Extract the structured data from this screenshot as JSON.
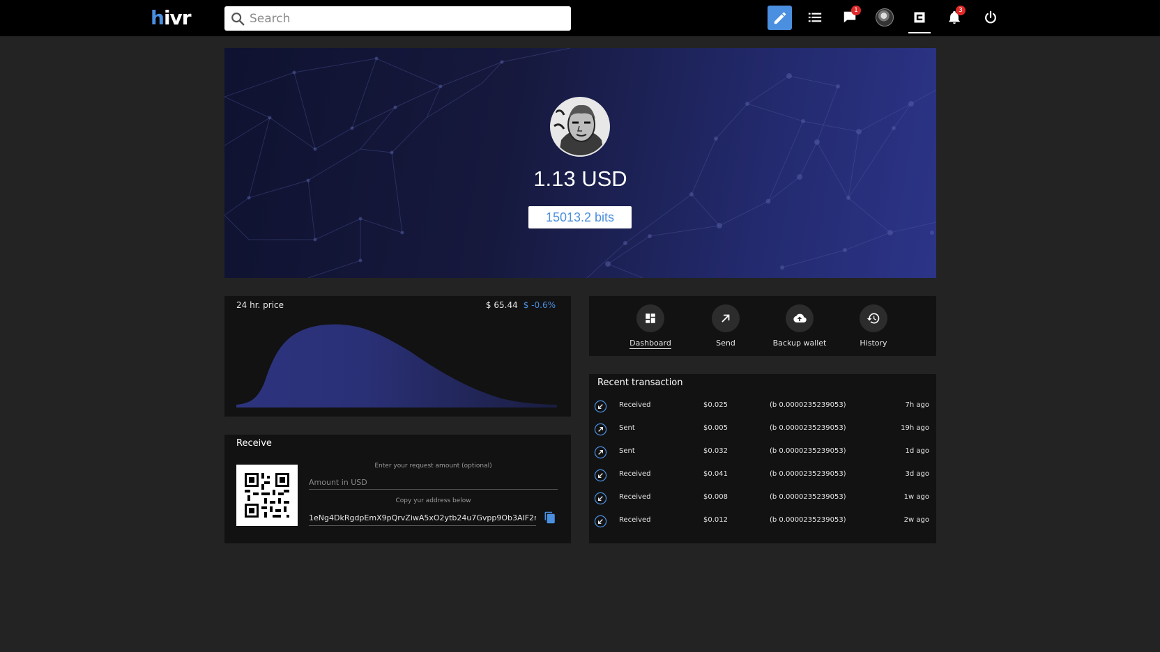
{
  "app": {
    "logo_text": "hivr"
  },
  "search": {
    "placeholder": "Search"
  },
  "nav": {
    "messages_badge": "1",
    "notifications_badge": "3"
  },
  "wallet": {
    "balance_usd": "1.13 USD",
    "balance_bits": "15013.2 bits"
  },
  "price": {
    "label": "24 hr. price",
    "value": "$ 65.44",
    "change": "$ -0.6%"
  },
  "actions": [
    {
      "label": "Dashboard",
      "icon": "dashboard-icon",
      "active": true
    },
    {
      "label": "Send",
      "icon": "send-arrow-icon",
      "active": false
    },
    {
      "label": "Backup wallet",
      "icon": "cloud-upload-icon",
      "active": false
    },
    {
      "label": "History",
      "icon": "history-icon",
      "active": false
    }
  ],
  "receive": {
    "title": "Receive",
    "request_hint": "Enter your request amount (optional)",
    "amount_placeholder": "Amount in USD",
    "copy_hint": "Copy yur address below",
    "address": "1eNg4DkRgdpEmX9pQrvZiwA5xO2ytb24u7Gvpp9Ob3AIF2r..."
  },
  "transactions": {
    "title": "Recent transaction",
    "rows": [
      {
        "type": "Received",
        "usd": "$0.025",
        "bits": "(b 0.0000235239053)",
        "time": "7h ago",
        "direction": "in"
      },
      {
        "type": "Sent",
        "usd": "$0.005",
        "bits": "(b 0.0000235239053)",
        "time": "19h ago",
        "direction": "out"
      },
      {
        "type": "Sent",
        "usd": "$0.032",
        "bits": "(b 0.0000235239053)",
        "time": "1d ago",
        "direction": "out"
      },
      {
        "type": "Received",
        "usd": "$0.041",
        "bits": "(b 0.0000235239053)",
        "time": "3d ago",
        "direction": "in"
      },
      {
        "type": "Received",
        "usd": "$0.008",
        "bits": "(b 0.0000235239053)",
        "time": "1w ago",
        "direction": "in"
      },
      {
        "type": "Received",
        "usd": "$0.012",
        "bits": "(b 0.0000235239053)",
        "time": "2w ago",
        "direction": "in"
      }
    ]
  },
  "colors": {
    "accent": "#4a8fe0",
    "badge": "#e02a2a",
    "hero_dark": "#0f1230",
    "hero_light": "#2c3488"
  }
}
